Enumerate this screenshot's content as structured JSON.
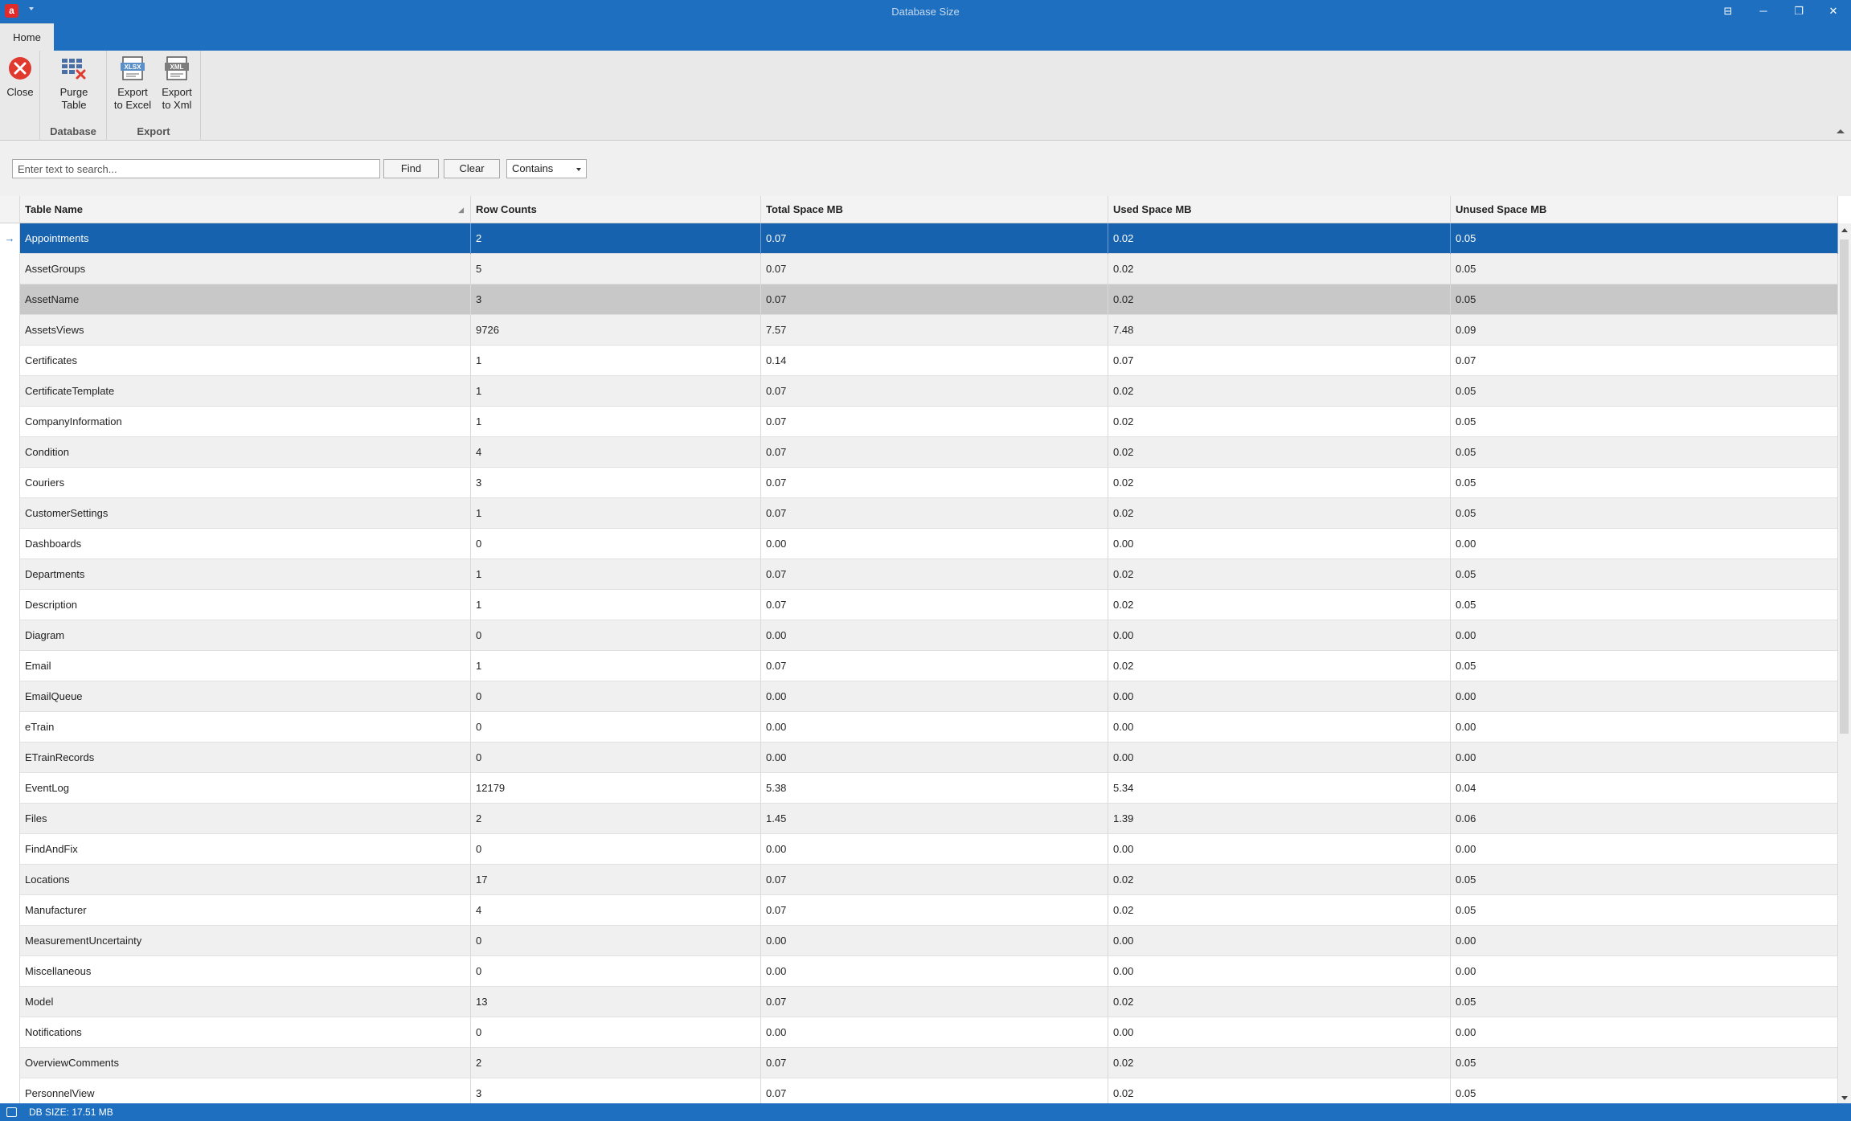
{
  "window": {
    "title": "Database Size",
    "app_icon_letter": "a",
    "controls": {
      "restore_panel": "⊟",
      "minimize": "─",
      "maximize": "❐",
      "close": "✕"
    }
  },
  "ribbon": {
    "tabs": [
      {
        "label": "Home",
        "active": true
      }
    ],
    "groups": [
      {
        "label": "",
        "buttons": [
          {
            "label": "Close",
            "icon": "close-circle-icon"
          }
        ]
      },
      {
        "label": "Database",
        "buttons": [
          {
            "label": "Purge Table",
            "icon": "purge-table-icon"
          }
        ]
      },
      {
        "label": "Export",
        "buttons": [
          {
            "label": "Export to Excel",
            "icon": "xlsx-file-icon"
          },
          {
            "label": "Export to Xml",
            "icon": "xml-file-icon"
          }
        ]
      }
    ],
    "close_label": "Close",
    "purge_line1": "Purge",
    "purge_line2": "Table",
    "excel_line1": "Export",
    "excel_line2": "to Excel",
    "xml_line1": "Export",
    "xml_line2": "to Xml",
    "database_group": "Database",
    "export_group": "Export"
  },
  "search": {
    "placeholder": "Enter text to search...",
    "find_label": "Find",
    "clear_label": "Clear",
    "mode_value": "Contains"
  },
  "grid": {
    "columns": [
      "Table Name",
      "Row Counts",
      "Total Space MB",
      "Used Space MB",
      "Unused Space MB"
    ],
    "rows": [
      [
        "Appointments",
        "2",
        "0.07",
        "0.02",
        "0.05"
      ],
      [
        "AssetGroups",
        "5",
        "0.07",
        "0.02",
        "0.05"
      ],
      [
        "AssetName",
        "3",
        "0.07",
        "0.02",
        "0.05"
      ],
      [
        "AssetsViews",
        "9726",
        "7.57",
        "7.48",
        "0.09"
      ],
      [
        "Certificates",
        "1",
        "0.14",
        "0.07",
        "0.07"
      ],
      [
        "CertificateTemplate",
        "1",
        "0.07",
        "0.02",
        "0.05"
      ],
      [
        "CompanyInformation",
        "1",
        "0.07",
        "0.02",
        "0.05"
      ],
      [
        "Condition",
        "4",
        "0.07",
        "0.02",
        "0.05"
      ],
      [
        "Couriers",
        "3",
        "0.07",
        "0.02",
        "0.05"
      ],
      [
        "CustomerSettings",
        "1",
        "0.07",
        "0.02",
        "0.05"
      ],
      [
        "Dashboards",
        "0",
        "0.00",
        "0.00",
        "0.00"
      ],
      [
        "Departments",
        "1",
        "0.07",
        "0.02",
        "0.05"
      ],
      [
        "Description",
        "1",
        "0.07",
        "0.02",
        "0.05"
      ],
      [
        "Diagram",
        "0",
        "0.00",
        "0.00",
        "0.00"
      ],
      [
        "Email",
        "1",
        "0.07",
        "0.02",
        "0.05"
      ],
      [
        "EmailQueue",
        "0",
        "0.00",
        "0.00",
        "0.00"
      ],
      [
        "eTrain",
        "0",
        "0.00",
        "0.00",
        "0.00"
      ],
      [
        "ETrainRecords",
        "0",
        "0.00",
        "0.00",
        "0.00"
      ],
      [
        "EventLog",
        "12179",
        "5.38",
        "5.34",
        "0.04"
      ],
      [
        "Files",
        "2",
        "1.45",
        "1.39",
        "0.06"
      ],
      [
        "FindAndFix",
        "0",
        "0.00",
        "0.00",
        "0.00"
      ],
      [
        "Locations",
        "17",
        "0.07",
        "0.02",
        "0.05"
      ],
      [
        "Manufacturer",
        "4",
        "0.07",
        "0.02",
        "0.05"
      ],
      [
        "MeasurementUncertainty",
        "0",
        "0.00",
        "0.00",
        "0.00"
      ],
      [
        "Miscellaneous",
        "0",
        "0.00",
        "0.00",
        "0.00"
      ],
      [
        "Model",
        "13",
        "0.07",
        "0.02",
        "0.05"
      ],
      [
        "Notifications",
        "0",
        "0.00",
        "0.00",
        "0.00"
      ],
      [
        "OverviewComments",
        "2",
        "0.07",
        "0.02",
        "0.05"
      ],
      [
        "PersonnelView",
        "3",
        "0.07",
        "0.02",
        "0.05"
      ]
    ],
    "selected_row": 0,
    "hover_row": 2,
    "row_indicator": "→"
  },
  "status": {
    "text": "DB SIZE: 17.51 MB",
    "icon": "database-status-icon"
  },
  "colors": {
    "accent": "#1e6fc0",
    "selection": "#1662ae",
    "close_red": "#e03a2f"
  }
}
